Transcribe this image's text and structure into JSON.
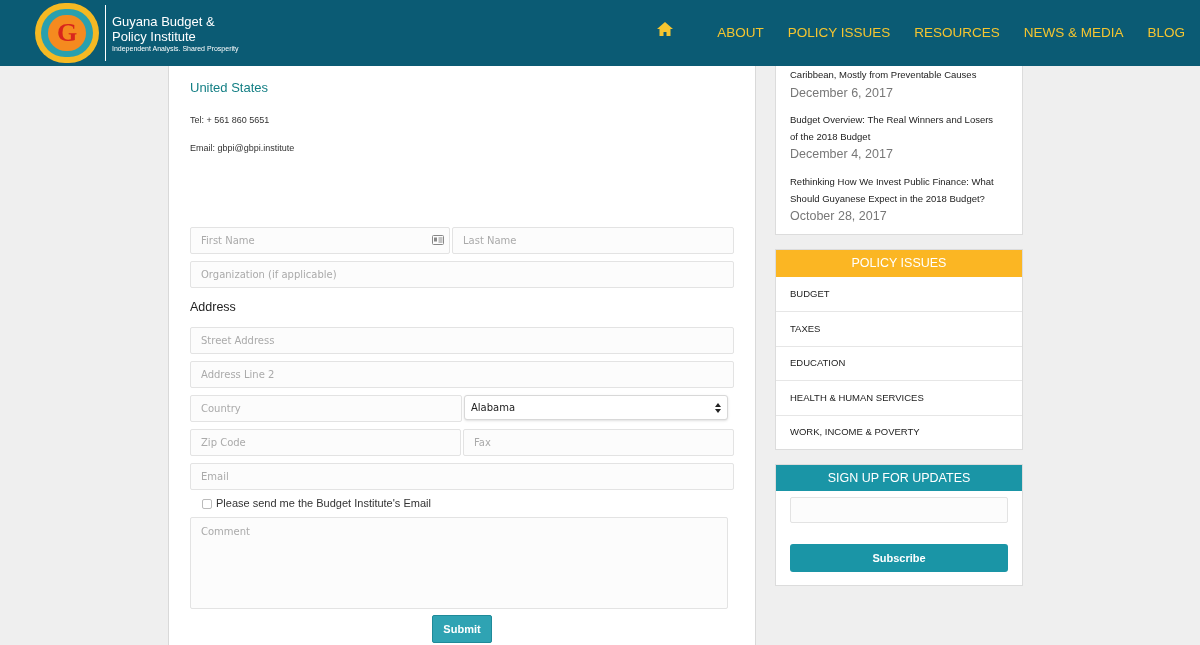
{
  "header": {
    "logo_letter": "G",
    "title_line1": "Guyana Budget &",
    "title_line2": "Policy Institute",
    "tagline": "Independent Analysis. Shared Prosperity",
    "nav": [
      {
        "kind": "home"
      },
      {
        "kind": "link",
        "label": "ABOUT"
      },
      {
        "kind": "link",
        "label": "POLICY ISSUES"
      },
      {
        "kind": "link",
        "label": "RESOURCES"
      },
      {
        "kind": "link",
        "label": "NEWS & MEDIA"
      },
      {
        "kind": "link",
        "label": "BLOG"
      }
    ]
  },
  "contact": {
    "country": "United States",
    "tel": "Tel: + 561 860 5651",
    "email": "Email: gbpi@gbpi.institute"
  },
  "form": {
    "items": [
      {
        "kind": "row",
        "fields": [
          {
            "kind": "name",
            "placeholder": "First Name"
          },
          {
            "kind": "text",
            "placeholder": "Last Name"
          }
        ]
      },
      {
        "kind": "row",
        "fields": [
          {
            "kind": "text",
            "placeholder": "Organization (if applicable)"
          }
        ]
      },
      {
        "kind": "heading",
        "label": "Address"
      },
      {
        "kind": "row",
        "fields": [
          {
            "kind": "text",
            "placeholder": "Street Address"
          }
        ]
      },
      {
        "kind": "row",
        "fields": [
          {
            "kind": "text",
            "placeholder": "Address Line 2"
          }
        ]
      },
      {
        "kind": "row",
        "fields": [
          {
            "kind": "text",
            "placeholder": "Country"
          },
          {
            "kind": "select",
            "value": "Alabama"
          }
        ]
      },
      {
        "kind": "row",
        "fields": [
          {
            "kind": "text",
            "placeholder": "Zip Code"
          },
          {
            "kind": "text",
            "placeholder": "Fax"
          }
        ]
      },
      {
        "kind": "row",
        "fields": [
          {
            "kind": "text",
            "placeholder": "Email"
          }
        ]
      },
      {
        "kind": "checkbox",
        "label": "Please send me the Budget Institute's Email",
        "checked": false
      },
      {
        "kind": "textarea",
        "placeholder": "Comment"
      }
    ],
    "submit": "Submit"
  },
  "sidebar": {
    "posts": [
      {
        "title": "Caribbean, Mostly from Preventable Causes",
        "date": "December 6, 2017"
      },
      {
        "title": "Budget Overview: The Real Winners and Losers of the 2018 Budget",
        "date": "December 4, 2017"
      },
      {
        "title": "Rethinking How We Invest Public Finance: What Should Guyanese Expect in the 2018 Budget?",
        "date": "October 28, 2017"
      }
    ],
    "policy_title": "POLICY ISSUES",
    "policy_items": [
      "BUDGET",
      "TAXES",
      "EDUCATION",
      "HEALTH & HUMAN SERVICES",
      "WORK, INCOME & POVERTY"
    ],
    "signup_title": "SIGN UP FOR UPDATES",
    "subscribe": "Subscribe"
  }
}
